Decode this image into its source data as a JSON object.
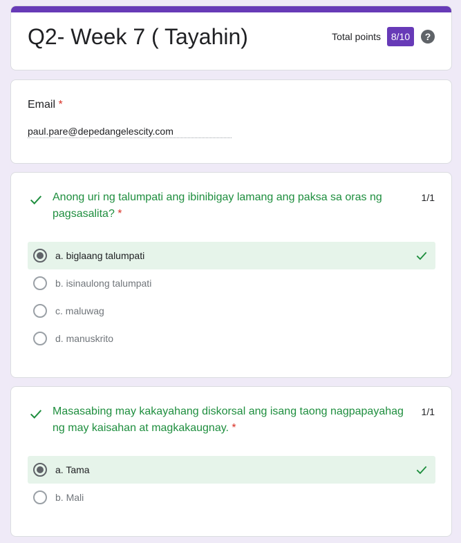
{
  "header": {
    "title": "Q2- Week 7 ( Tayahin)",
    "points_label": "Total points",
    "points_value": "8/10",
    "help_glyph": "?"
  },
  "email": {
    "label": "Email",
    "required_mark": "*",
    "value": "paul.pare@depedangelescity.com"
  },
  "questions": [
    {
      "title": "Anong uri ng talumpati ang ibinibigay lamang ang paksa sa oras ng pagsasalita?",
      "required_mark": "*",
      "score": "1/1",
      "options": [
        {
          "label": "a. biglaang talumpati",
          "selected": true,
          "correct": true
        },
        {
          "label": "b. isinaulong talumpati",
          "selected": false,
          "correct": false
        },
        {
          "label": "c. maluwag",
          "selected": false,
          "correct": false
        },
        {
          "label": "d. manuskrito",
          "selected": false,
          "correct": false
        }
      ]
    },
    {
      "title": "Masasabing may kakayahang diskorsal ang isang taong nagpapayahag ng may kaisahan at magkakaugnay.",
      "required_mark": "*",
      "score": "1/1",
      "options": [
        {
          "label": "a. Tama",
          "selected": true,
          "correct": true
        },
        {
          "label": "b. Mali",
          "selected": false,
          "correct": false
        }
      ]
    }
  ],
  "icons": {
    "correct": "check-icon",
    "help": "help-circle-icon"
  },
  "colors": {
    "accent": "#673ab7",
    "correct_text": "#1e8e3e",
    "correct_bg": "#e6f4ea",
    "required": "#d93025",
    "background": "#efeaf7"
  }
}
